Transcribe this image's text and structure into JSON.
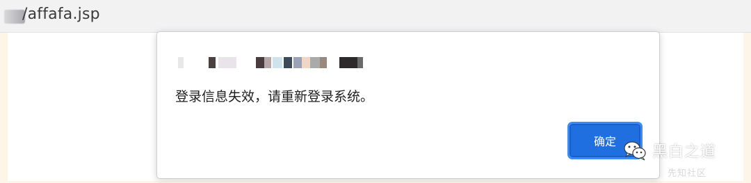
{
  "browser": {
    "url_suffix": "/affafa.jsp"
  },
  "dialog": {
    "message": "登录信息失效，请重新登录系统。",
    "ok_label": "确定"
  },
  "watermark": {
    "name": "黑白之道",
    "community": "先知社区",
    "icon": "wechat-icon"
  },
  "colors": {
    "button_bg": "#1f6fe0",
    "button_focus_ring": "#3d8bf2",
    "page_bg": "#fdf6e8",
    "address_bar_bg": "#f2f2f3"
  }
}
